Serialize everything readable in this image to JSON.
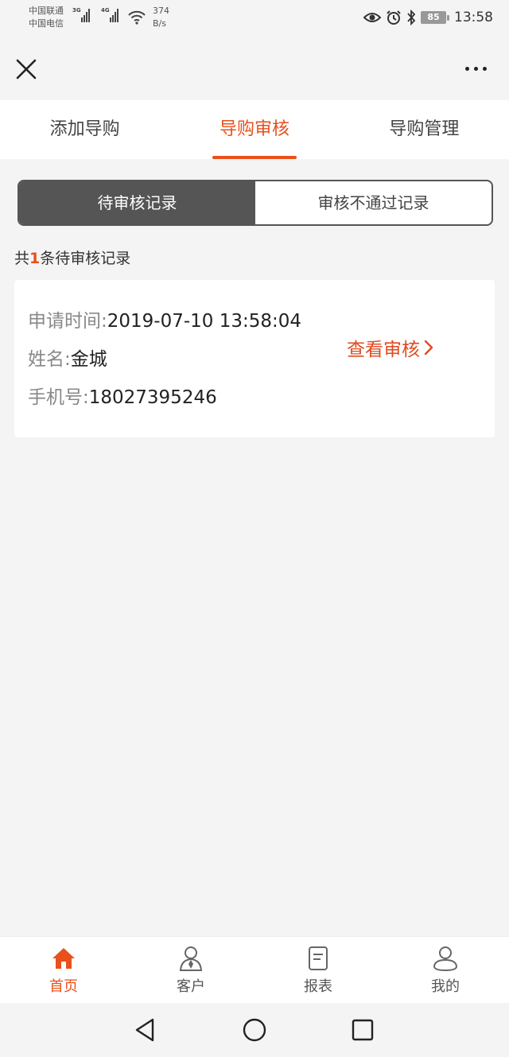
{
  "status_bar": {
    "carrier_1": "中国联通",
    "carrier_2": "中国电信",
    "network_1": "3G",
    "network_2": "4G",
    "speed_value": "374",
    "speed_unit": "B/s",
    "battery": "85",
    "time": "13:58",
    "icons": [
      "eye-icon",
      "alarm-icon",
      "bluetooth-icon",
      "battery-icon"
    ]
  },
  "navbar": {
    "close_icon": "close-icon",
    "more_icon": "more-icon"
  },
  "tabs": [
    {
      "label": "添加导购",
      "active": false
    },
    {
      "label": "导购审核",
      "active": true
    },
    {
      "label": "导购管理",
      "active": false
    }
  ],
  "segment": {
    "pending": "待审核记录",
    "rejected": "审核不通过记录"
  },
  "count": {
    "prefix": "共",
    "number": "1",
    "suffix": "条待审核记录"
  },
  "record": {
    "apply_time_label": "申请时间:",
    "apply_time_value": "2019-07-10 13:58:04",
    "name_label": "姓名:",
    "name_value": "金城",
    "phone_label": "手机号:",
    "phone_value": "18027395246",
    "action": "查看审核"
  },
  "bottom_nav": [
    {
      "label": "首页",
      "icon": "home-icon",
      "active": true
    },
    {
      "label": "客户",
      "icon": "customer-icon",
      "active": false
    },
    {
      "label": "报表",
      "icon": "report-icon",
      "active": false
    },
    {
      "label": "我的",
      "icon": "profile-icon",
      "active": false
    }
  ],
  "colors": {
    "accent": "#e8501c",
    "segment_active": "#555555",
    "background": "#f4f4f5"
  }
}
